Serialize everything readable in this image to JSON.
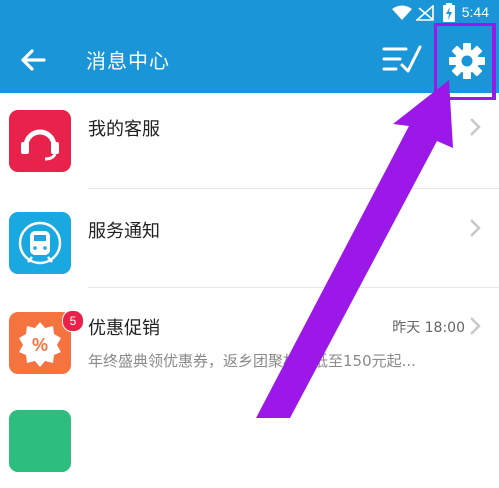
{
  "status_bar": {
    "time": "5:44"
  },
  "app_bar": {
    "title": "消息中心"
  },
  "messages": [
    {
      "name": "我的客服",
      "icon": "headset-icon",
      "color": "#e8224a"
    },
    {
      "name": "服务通知",
      "icon": "train-icon",
      "color": "#1aa8e0"
    },
    {
      "name": "优惠促销",
      "icon": "discount-icon",
      "color": "#f4733f",
      "time": "昨天 18:00",
      "preview": "年终盛典领优惠券，返乡团聚机票低至150元起...",
      "badge": "5"
    }
  ],
  "colors": {
    "primary": "#1a95d8",
    "highlight": "#9b18e8",
    "badge": "#e8224a"
  }
}
